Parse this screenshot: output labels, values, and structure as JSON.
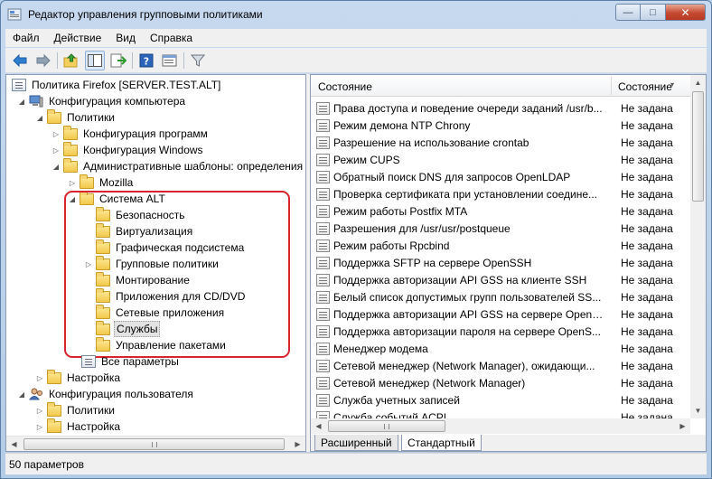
{
  "window": {
    "title": "Редактор управления групповыми политиками"
  },
  "caption": {
    "minimize": "—",
    "maximize": "□",
    "close": "✕"
  },
  "menu": [
    "Файл",
    "Действие",
    "Вид",
    "Справка"
  ],
  "toolbar": {
    "icons": [
      "back-icon",
      "forward-icon",
      "up-folder-icon",
      "show-hide-tree-icon",
      "export-list-icon",
      "help-icon",
      "properties-icon",
      "filter-icon"
    ]
  },
  "tree": {
    "root": "Политика Firefox [SERVER.TEST.ALT]",
    "computer_config": "Конфигурация компьютера",
    "policies": "Политики",
    "software_config": "Конфигурация программ",
    "windows_config": "Конфигурация Windows",
    "admin_templates": "Административные шаблоны: определения",
    "mozilla": "Mozilla",
    "alt_system": "Система ALT",
    "security": "Безопасность",
    "virtualization": "Виртуализация",
    "graphics": "Графическая подсистема",
    "group_policies": "Групповые политики",
    "mounting": "Монтирование",
    "cd_dvd": "Приложения для CD/DVD",
    "network_apps": "Сетевые приложения",
    "services": "Службы",
    "package_mgmt": "Управление пакетами",
    "all_params": "Все параметры",
    "settings": "Настройка",
    "user_config": "Конфигурация пользователя",
    "user_policies": "Политики",
    "user_settings": "Настройка"
  },
  "list": {
    "header_name": "Состояние",
    "header_state": "Состояние",
    "rows": [
      {
        "name": "Права доступа и поведение очереди заданий /usr/b...",
        "state": "Не задана"
      },
      {
        "name": "Режим демона NTP Chrony",
        "state": "Не задана"
      },
      {
        "name": "Разрешение на использование crontab",
        "state": "Не задана"
      },
      {
        "name": "Режим CUPS",
        "state": "Не задана"
      },
      {
        "name": "Обратный поиск DNS для запросов OpenLDAP",
        "state": "Не задана"
      },
      {
        "name": "Проверка сертификата при установлении соедине...",
        "state": "Не задана"
      },
      {
        "name": "Режим работы Postfix MTA",
        "state": "Не задана"
      },
      {
        "name": "Разрешения для /usr/usr/postqueue",
        "state": "Не задана"
      },
      {
        "name": "Режим работы Rpcbind",
        "state": "Не задана"
      },
      {
        "name": "Поддержка SFTP на сервере OpenSSH",
        "state": "Не задана"
      },
      {
        "name": "Поддержка авторизации API GSS на клиенте SSH",
        "state": "Не задана"
      },
      {
        "name": "Белый список допустимых групп пользователей SS...",
        "state": "Не задана"
      },
      {
        "name": "Поддержка авторизации API GSS на сервере OpenS...",
        "state": "Не задана"
      },
      {
        "name": "Поддержка авторизации пароля на сервере OpenS...",
        "state": "Не задана"
      },
      {
        "name": "Менеджер модема",
        "state": "Не задана"
      },
      {
        "name": "Сетевой менеджер (Network Manager), ожидающи...",
        "state": "Не задана"
      },
      {
        "name": "Сетевой менеджер (Network Manager)",
        "state": "Не задана"
      },
      {
        "name": "Служба учетных записей",
        "state": "Не задана"
      },
      {
        "name": "Служба событий ACPI",
        "state": "Не задана"
      }
    ]
  },
  "tabs": {
    "extended": "Расширенный",
    "standard": "Стандартный"
  },
  "statusbar": {
    "text": "50 параметров"
  }
}
